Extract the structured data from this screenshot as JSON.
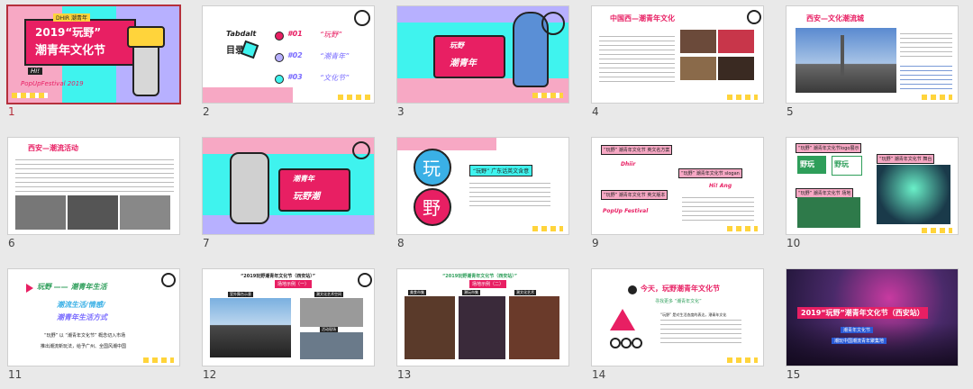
{
  "slides": [
    {
      "number": "1",
      "title_line1": "2019“玩野”",
      "title_line2": "潮青年文化节",
      "badge": "DHIR 潮青年",
      "brand": "PopUpFestival 2019",
      "chip": "Hi!"
    },
    {
      "number": "2",
      "heading": "Tabdalt",
      "sub": "目录",
      "items": [
        {
          "no": "#01",
          "label": "“玩野”"
        },
        {
          "no": "#02",
          "label": "“潮青年”"
        },
        {
          "no": "#03",
          "label": "“文化节”"
        }
      ]
    },
    {
      "number": "3",
      "card_line1": "玩野",
      "card_line2": "潮青年"
    },
    {
      "number": "4",
      "title": "中国西—潮青年文化"
    },
    {
      "number": "5",
      "title": "西安—文化潮流城"
    },
    {
      "number": "6",
      "title": "西安—潮流活动"
    },
    {
      "number": "7",
      "card_line1": "潮青年",
      "card_line2": "玩野潮"
    },
    {
      "number": "8",
      "char1": "玩",
      "char2": "野",
      "tag": "“玩野” 广东话英文含意"
    },
    {
      "number": "9",
      "label1": "“玩野” 潮青年文化节 英文名方案",
      "label2": "“玩野” 潮青年文化节 slogan",
      "label3": "“玩野” 潮青年文化节 英文版本",
      "brand1": "Dhiir",
      "brand2": "Hi! Ang",
      "brand3": "PopUp Festival"
    },
    {
      "number": "10",
      "label1": "“玩野” 潮青年文化节logo展示",
      "label2": "“玩野” 潮青年文化节 舞台",
      "label3": "“玩野” 潮青年文化节 场地",
      "logo1": "野玩",
      "logo2": "野玩"
    },
    {
      "number": "11",
      "title": "玩野 —— 潮青年生活",
      "line1": "潮流生活/情感/",
      "line2": "潮青年生活方式",
      "text1": "“玩野” 以 “潮青年文化节” 概念切入市场",
      "text2": "推出潮流新玩法，给予广州、全国风潮中国"
    },
    {
      "number": "12",
      "title": "“2019玩野潮青年文化节（西安站）”",
      "tag": "场地示例（一）",
      "cap1": "室外舞台示意",
      "cap2": "潮文化艺术空间",
      "cap3": "活动现场"
    },
    {
      "number": "13",
      "title": "“2019玩野潮青年文化节（西安站）”",
      "tag": "场地示例（二）",
      "cap1": "美食市集",
      "cap2": "潮玩市集",
      "cap3": "潮文化艺术"
    },
    {
      "number": "14",
      "title": "今天，玩野潮青年文化节",
      "sub": "寻找更多 “潮青年文化”",
      "text": "“玩野” 是对生活态度的表达，潮青年文化"
    },
    {
      "number": "15",
      "title": "2019“玩野”潮青年文化节（西安站）",
      "sub1": "潮青年文化节",
      "sub2": "潮玩中国潮流青年聚集地"
    }
  ]
}
